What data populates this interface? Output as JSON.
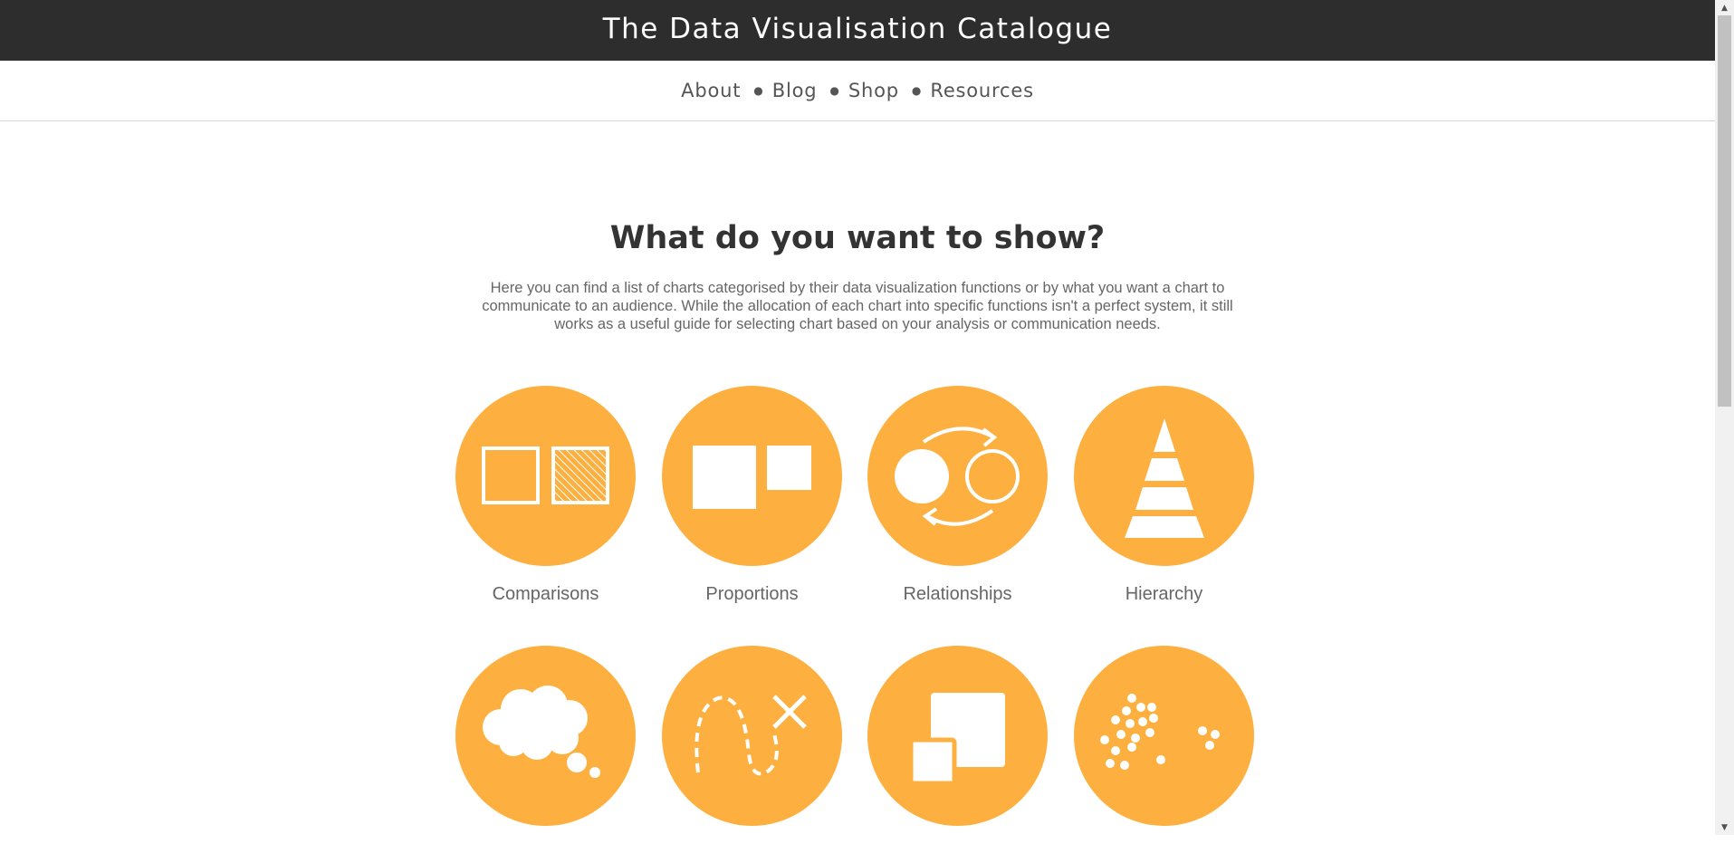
{
  "header": {
    "title": "The Data Visualisation Catalogue"
  },
  "nav": {
    "items": [
      {
        "label": "About"
      },
      {
        "label": "Blog"
      },
      {
        "label": "Shop"
      },
      {
        "label": "Resources"
      }
    ]
  },
  "main": {
    "heading": "What do you want to show?",
    "intro": "Here you can find a list of charts categorised by their data visualization functions or by what you want a chart to communicate to an audience. While the allocation of each chart into specific functions isn't a perfect system, it still works as a useful guide for selecting chart based on your analysis or communication needs.",
    "categories": [
      {
        "label": "Comparisons",
        "icon": "comparison-squares-icon"
      },
      {
        "label": "Proportions",
        "icon": "proportion-squares-icon"
      },
      {
        "label": "Relationships",
        "icon": "relationship-circles-icon"
      },
      {
        "label": "Hierarchy",
        "icon": "pyramid-icon"
      },
      {
        "label": "",
        "icon": "thought-cloud-icon"
      },
      {
        "label": "",
        "icon": "dashed-path-x-icon"
      },
      {
        "label": "",
        "icon": "overlapping-squares-icon"
      },
      {
        "label": "",
        "icon": "dot-clusters-icon"
      }
    ]
  },
  "colors": {
    "header_bg": "#2d2d2d",
    "accent": "#fdb03f",
    "text": "#666666"
  }
}
